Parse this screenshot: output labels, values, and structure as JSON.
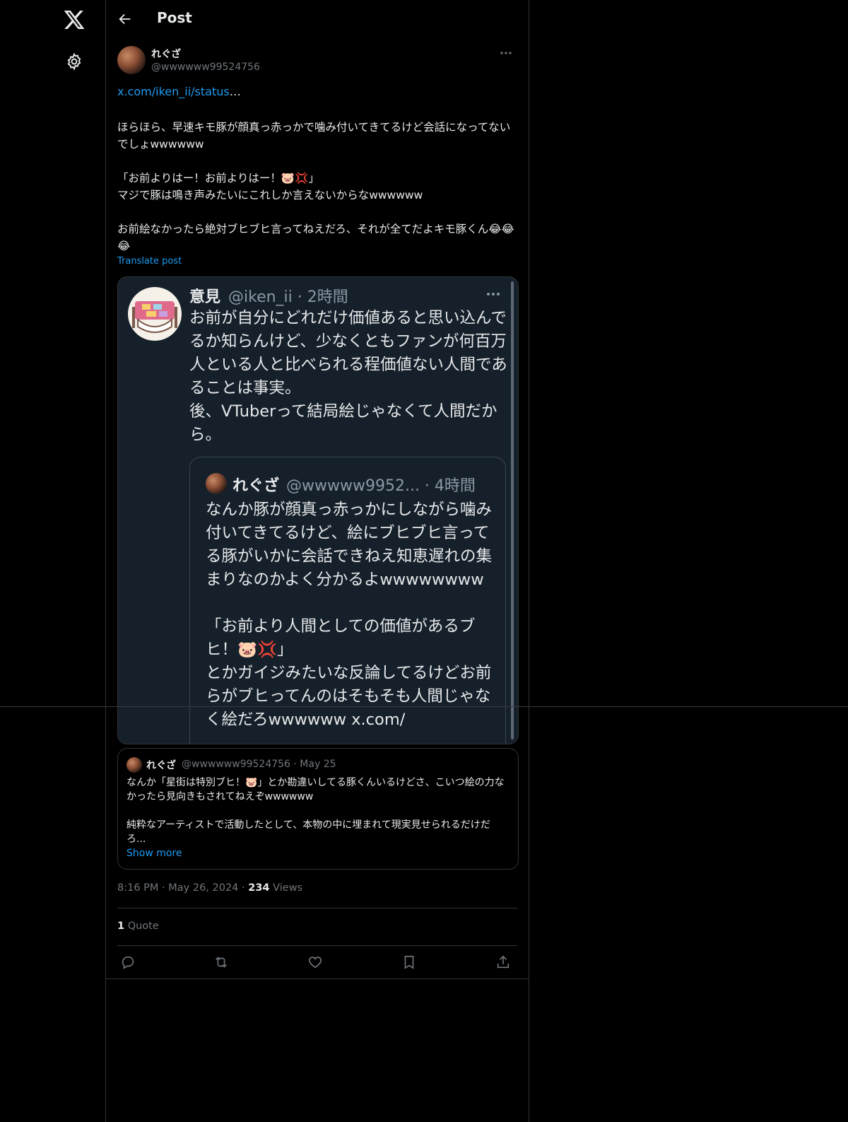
{
  "header": {
    "title": "Post"
  },
  "post": {
    "author_name": "れぐざ",
    "author_handle": "@wwwwww99524756",
    "link_text": "x.com/iken_ii/status",
    "link_ellipsis": "…",
    "paragraph1": "ほらほら、早速キモ豚が顔真っ赤っかで噛み付いてきてるけど会話になってないでしょwwwwww",
    "paragraph2_line1": "「お前よりはー！お前よりはー！🐷💢」",
    "paragraph2_line2": "マジで豚は鳴き声みたいにこれしか言えないからなwwwwww",
    "paragraph3": "お前絵なかったら絶対ブヒブヒ言ってねえだろ、それが全てだよキモ豚くん😂😂😂",
    "translate_label": "Translate post",
    "timestamp": "8:16 PM · May 26, 2024 · ",
    "views_count": "234",
    "views_label": " Views",
    "quote_count": "1",
    "quote_label": " Quote"
  },
  "screenshot": {
    "name": "意見",
    "handle_time": "@iken_ii · 2時間",
    "text": "お前が自分にどれだけ価値あると思い込んでるか知らんけど、少なくともファンが何百万人といる人と比べられる程価値ない人間であることは事実。\n後、VTuberって結局絵じゃなくて人間だから。",
    "inner_name": "れぐざ",
    "inner_handle_time": "@wwwww9952... · 4時間",
    "inner_text": "なんか豚が顔真っ赤っかにしながら噛み付いてきてるけど、絵にブヒブヒ言ってる豚がいかに会話できねえ知恵遅れの集まりなのかよく分かるよwwwwwwww\n\n「お前より人間としての価値があるブヒ！🐷💢」\nとかガイジみたいな反論してるけどお前らがブヒってんのはそもそも人間じゃなく絵だろwwwwww x.com/"
  },
  "quoted_post": {
    "name": "れぐざ",
    "meta": "@wwwwww99524756 · May 25",
    "text": "なんか「星街は特別ブヒ！🐷」とか勘違いしてる豚くんいるけどさ、こいつ絵の力なかったら見向きもされてねえぞwwwwww\n\n純粋なアーティストで活動したとして、本物の中に埋まれて現実見せられるだけだろ...",
    "show_more": "Show more"
  },
  "icons": {
    "logo": "x-logo-icon",
    "settings": "gear-icon",
    "back": "arrow-left-icon",
    "more": "more-horizontal-icon",
    "reply": "reply-icon",
    "repost": "repost-icon",
    "like": "heart-icon",
    "bookmark": "bookmark-icon",
    "share": "share-icon"
  },
  "colors": {
    "background": "#000000",
    "text": "#e7e9ea",
    "muted": "#71767b",
    "accent": "#1d9bf0",
    "border": "#2f3336",
    "screenshot_bg": "#15202b"
  }
}
